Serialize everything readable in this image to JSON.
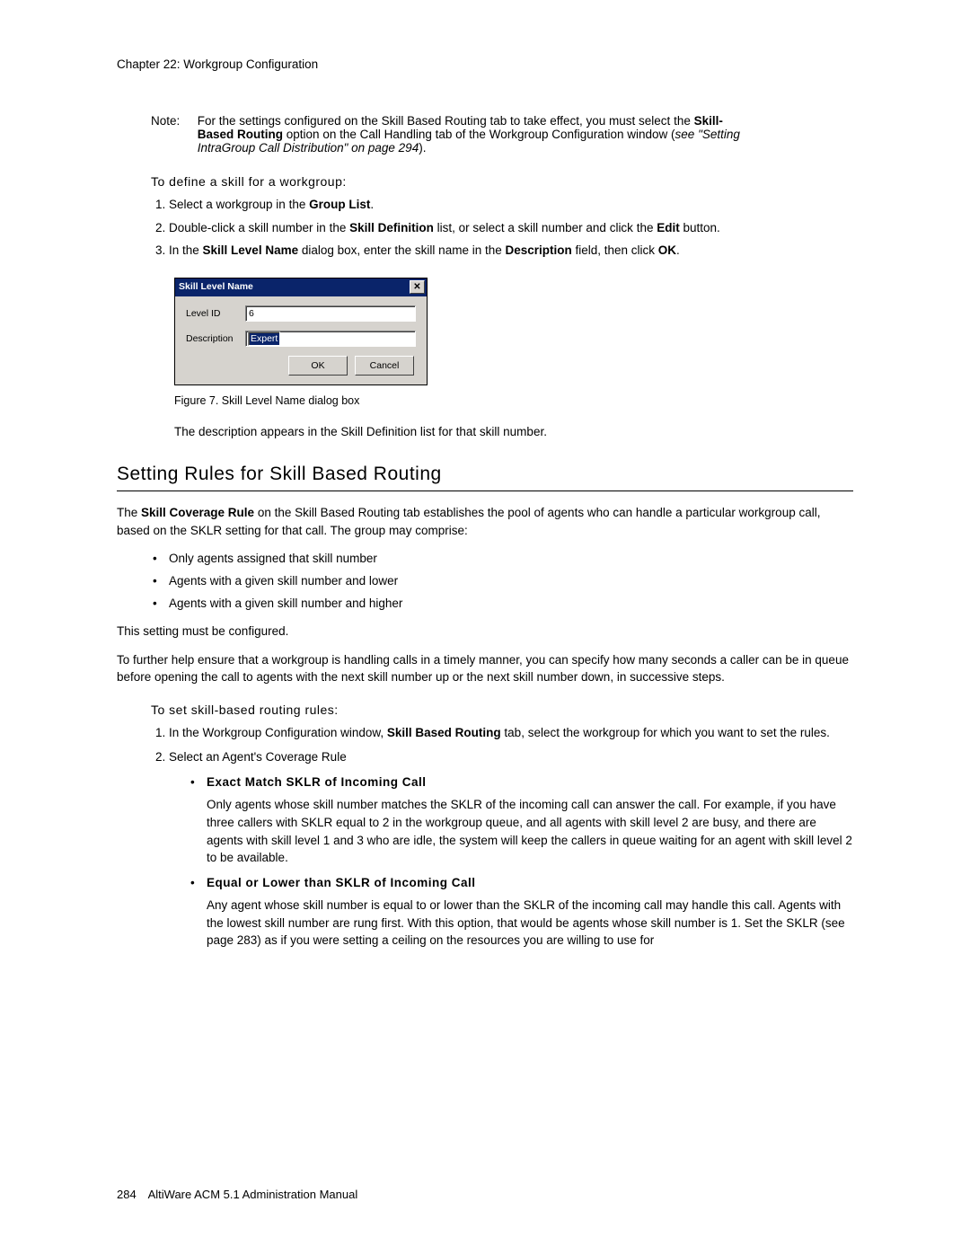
{
  "chapter_header": "Chapter 22:  Workgroup Configuration",
  "note": {
    "label": "Note:",
    "text_prefix": "For the settings configured on the Skill Based Routing tab to take effect, you must select the ",
    "text_bold": "Skill-Based Routing",
    "text_mid": " option on the Call Handling tab of the Workgroup Configuration window (",
    "text_italic": "see \"Setting IntraGroup Call Distribution\" on page 294",
    "text_suffix": ")."
  },
  "subhead_define": "To define a skill for a workgroup:",
  "steps_define": [
    {
      "pre": "Select a workgroup in the ",
      "b": "Group List",
      "post": "."
    },
    {
      "pre": "Double-click a skill number in the ",
      "b": "Skill Definition",
      "post": " list, or select a skill number and click the ",
      "b2": "Edit",
      "post2": " button."
    },
    {
      "pre": "In the ",
      "b": "Skill Level Name",
      "post": " dialog box, enter the skill name in the ",
      "b2": "Description",
      "post2": " field, then click ",
      "b3": "OK",
      "post3": "."
    }
  ],
  "dialog": {
    "title": "Skill Level Name",
    "close": "✕",
    "level_id_label": "Level ID",
    "level_id_value": "6",
    "description_label": "Description",
    "description_value": "Expert",
    "ok": "OK",
    "cancel": "Cancel"
  },
  "figure_caption": "Figure 7.    Skill Level Name dialog box",
  "post_figure_para": "The description appears in the Skill Definition list for that skill number.",
  "section_heading": "Setting Rules for Skill Based Routing",
  "coverage_para": {
    "pre": "The ",
    "b": "Skill Coverage Rule",
    "post": " on the Skill Based Routing tab establishes the pool of agents who can handle a particular workgroup call, based on the SKLR setting for that call. The group may comprise:"
  },
  "coverage_bullets": [
    "Only agents assigned that skill number",
    "Agents with a given skill number and lower",
    "Agents with a given skill number and higher"
  ],
  "must_configure": "This setting must be configured.",
  "further_para": "To further help ensure that a workgroup is handling calls in a timely manner, you can specify how many seconds a caller can be in queue before opening the call to agents with the next skill number up or the next skill number down, in successive steps.",
  "subhead_rules": "To set skill-based routing rules:",
  "steps_rules": {
    "s1": {
      "pre": "In the Workgroup Configuration window, ",
      "b": "Skill Based Routing",
      "post": " tab, select the workgroup for which you want to set the rules."
    },
    "s2": {
      "text": "Select an Agent's Coverage Rule",
      "sub": [
        {
          "title": "Exact Match SKLR of Incoming Call",
          "body": "Only agents whose skill number matches the SKLR of the incoming call can answer the call. For example, if you have three callers with SKLR equal to 2 in the workgroup queue, and all agents with skill level 2 are busy, and there are agents with skill level 1 and 3 who are idle, the system will keep the callers in queue waiting for an agent with skill level 2 to be available."
        },
        {
          "title": "Equal or Lower than SKLR of Incoming Call",
          "body": "Any agent whose skill number is equal to or lower than the SKLR of the incoming call may handle this call. Agents with the lowest skill number are rung first. With this option, that would be agents whose skill number is 1. Set the SKLR (see page 283) as if you were setting a ceiling on the resources you are willing to use for"
        }
      ]
    }
  },
  "footer": {
    "page": "284",
    "title": "AltiWare ACM 5.1 Administration Manual"
  }
}
